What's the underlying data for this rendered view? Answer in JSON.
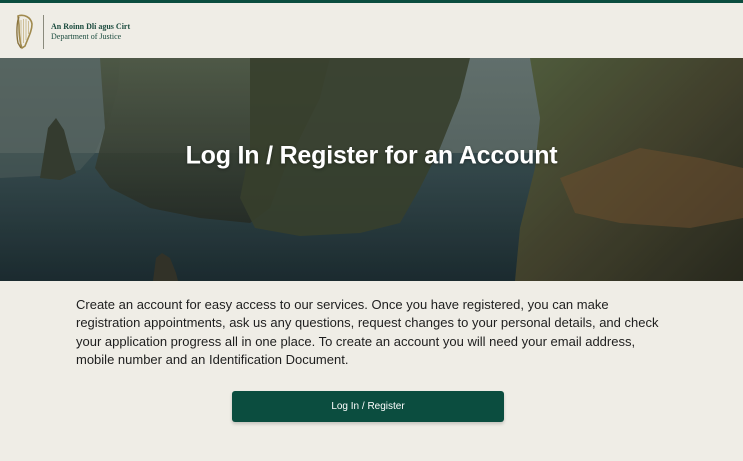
{
  "header": {
    "logo_line1": "An Roinn Dlí agus Cirt",
    "logo_line2": "Department of Justice",
    "logo_icon": "harp-icon"
  },
  "hero": {
    "title": "Log In / Register for an Account"
  },
  "main": {
    "intro": "Create an account for easy access to our services. Once you have registered, you can make registration appointments, ask us any questions, request changes to your personal details, and check your application progress all in one place. To create an account you will need your email address, mobile number and an Identification Document.",
    "cta_label": "Log In / Register"
  },
  "colors": {
    "brand": "#0b4d3f",
    "page_bg": "#efede6",
    "button_text": "#ffffff"
  }
}
